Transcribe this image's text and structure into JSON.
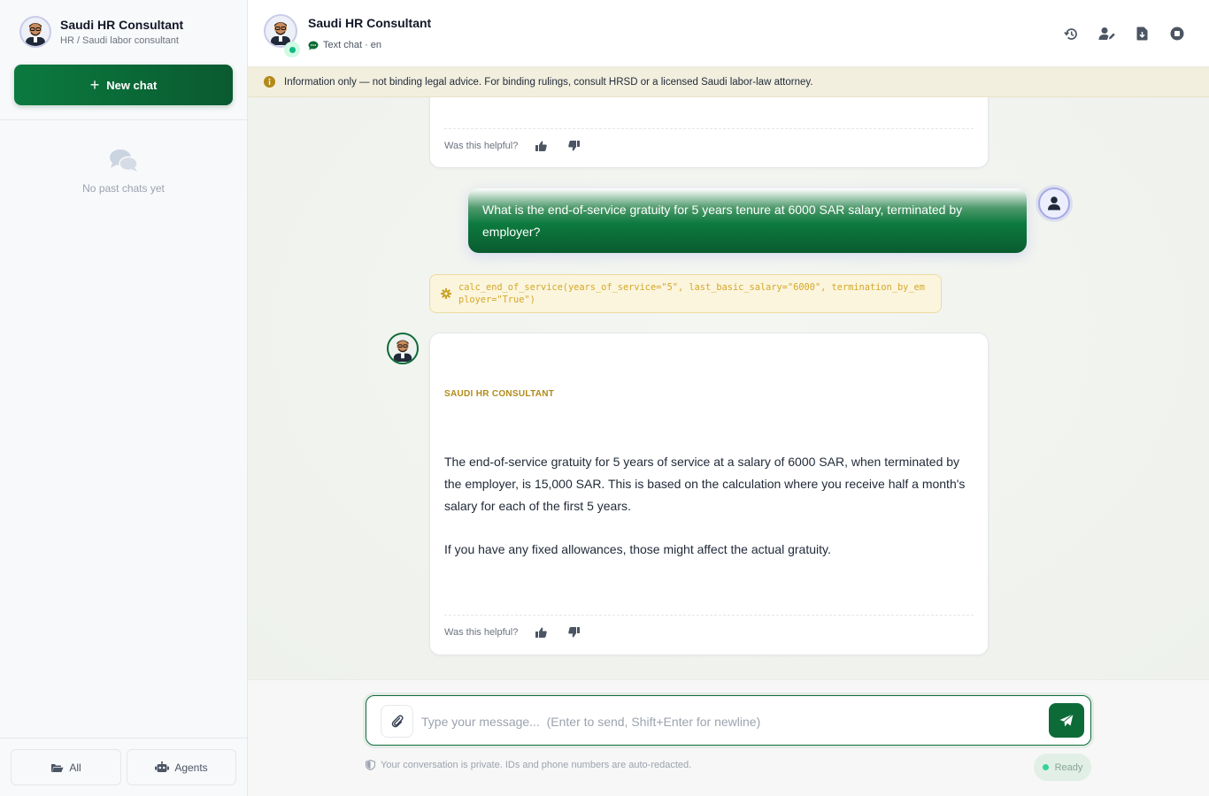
{
  "sidebar": {
    "agent_name": "Saudi HR Consultant",
    "agent_role": "HR / Saudi labor consultant",
    "new_chat_label": "New chat",
    "empty_label": "No past chats yet",
    "filter_all_label": "All",
    "filter_agents_label": "Agents"
  },
  "header": {
    "title": "Saudi HR Consultant",
    "subtitle": "Text chat · en",
    "actions": [
      "history-icon",
      "user-edit-icon",
      "download-file-icon",
      "stop-icon"
    ]
  },
  "notice": {
    "text": "Information only — not binding legal advice. For binding rulings, consult HRSD or a licensed Saudi labor-law attorney."
  },
  "messages": {
    "prev_feedback_label": "Was this helpful?",
    "user_message": "What is the end-of-service gratuity for 5 years tenure at 6000 SAR salary, terminated by employer?",
    "tool_call": "calc_end_of_service(years_of_service=\"5\", last_basic_salary=\"6000\", termination_by_employer=\"True\")",
    "bot_name": "SAUDI HR CONSULTANT",
    "bot_paragraph_1": "The end-of-service gratuity for 5 years of service at a salary of 6000 SAR, when terminated by the employer, is 15,000 SAR. This is based on the calculation where you receive half a month's salary for each of the first 5 years.",
    "bot_paragraph_2": "If you have any fixed allowances, those might affect the actual gratuity.",
    "bot_feedback_label": "Was this helpful?"
  },
  "composer": {
    "placeholder": "Type your message...  (Enter to send, Shift+Enter for newline)",
    "value": "",
    "privacy_text": "Your conversation is private. IDs and phone numbers are auto-redacted.",
    "status": "Ready"
  },
  "colors": {
    "brand_green": "#0b6b37",
    "accent_gold": "#b38a18",
    "notice_bg": "#f2efdf"
  }
}
